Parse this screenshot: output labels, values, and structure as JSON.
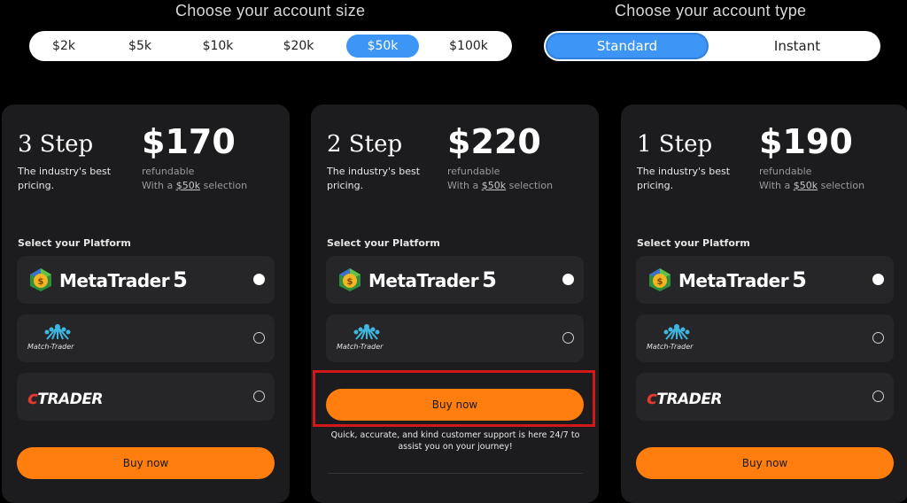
{
  "account_size": {
    "heading": "Choose your account size",
    "options": [
      "$2k",
      "$5k",
      "$10k",
      "$20k",
      "$50k",
      "$100k"
    ],
    "selected": "$50k"
  },
  "account_type": {
    "heading": "Choose your account type",
    "options": [
      "Standard",
      "Instant"
    ],
    "selected": "Standard"
  },
  "cards": [
    {
      "step": "3 Step",
      "description": "The industry's best pricing.",
      "price": "$170",
      "refund": "refundable",
      "selection_prefix": "With a",
      "selection_value": "$50k",
      "selection_suffix": "selection",
      "platform_title": "Select your Platform",
      "platforms": [
        "MetaTrader 5",
        "Match-Trader",
        "cTrader"
      ],
      "selected_platform": "MetaTrader 5",
      "buy_label": "Buy now"
    },
    {
      "step": "2 Step",
      "description": "The industry's best pricing.",
      "price": "$220",
      "refund": "refundable",
      "selection_prefix": "With a",
      "selection_value": "$50k",
      "selection_suffix": "selection",
      "platform_title": "Select your Platform",
      "platforms": [
        "MetaTrader 5",
        "Match-Trader"
      ],
      "selected_platform": "MetaTrader 5",
      "buy_label": "Buy now",
      "support_text": "Quick, accurate, and kind customer support is here 24/7 to assist you on your journey!"
    },
    {
      "step": "1 Step",
      "description": "The industry's best pricing.",
      "price": "$190",
      "refund": "refundable",
      "selection_prefix": "With a",
      "selection_value": "$50k",
      "selection_suffix": "selection",
      "platform_title": "Select your Platform",
      "platforms": [
        "MetaTrader 5",
        "Match-Trader",
        "cTrader"
      ],
      "selected_platform": "MetaTrader 5",
      "buy_label": "Buy now"
    }
  ],
  "logos": {
    "mt5_word": "MetaTrader",
    "mt5_num": "5",
    "match_word": "Match-Trader",
    "ctrader_c": "c",
    "ctrader_rest": "TRADER"
  },
  "colors": {
    "accent_blue": "#3d96f5",
    "buy_orange": "#ff7e0e",
    "card_bg": "#1c1c1e",
    "highlight_red": "#d21818"
  }
}
